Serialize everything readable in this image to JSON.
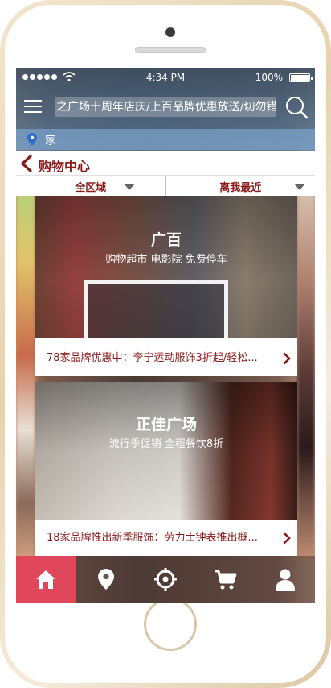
{
  "status_bar": {
    "time": "4:34 PM",
    "battery": "100%"
  },
  "nav": {
    "search_text": "之广场十周年店庆/上百品牌优惠放送/切勿错过"
  },
  "location": {
    "name": "家"
  },
  "page": {
    "title": "购物中心"
  },
  "filters": [
    {
      "label": "全区域"
    },
    {
      "label": "离我最近"
    }
  ],
  "cards": [
    {
      "name": "广百",
      "subtitle": "购物超市 电影院 免费停车",
      "promo": "78家品牌优惠中：李宁运动服饰3折起/轻松..."
    },
    {
      "name": "正佳广场",
      "subtitle": "流行季促销 全程餐饮8折",
      "promo": "18家品牌推出新季服饰：劳力士钟表推出概..."
    }
  ],
  "tabs": [
    {
      "icon": "home-icon",
      "active": true
    },
    {
      "icon": "location-pin-icon",
      "active": false
    },
    {
      "icon": "crosshair-icon",
      "active": false
    },
    {
      "icon": "cart-icon",
      "active": false
    },
    {
      "icon": "user-icon",
      "active": false
    }
  ],
  "colors": {
    "accent": "#8b1a1a",
    "active_tab": "#e0475a"
  }
}
